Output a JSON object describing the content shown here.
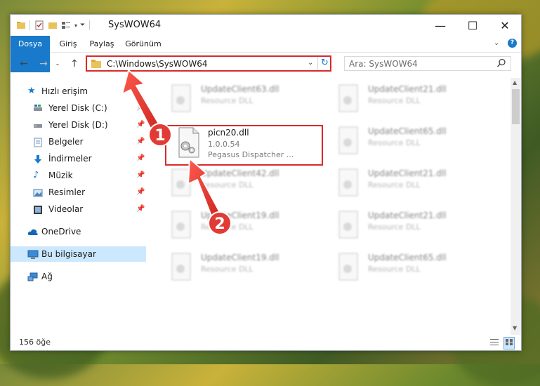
{
  "window": {
    "title": "SysWOW64",
    "minimize_glyph": "—",
    "maximize_glyph": "☐",
    "close_glyph": "✕"
  },
  "ribbon": {
    "tabs": [
      "Dosya",
      "Giriş",
      "Paylaş",
      "Görünüm"
    ]
  },
  "navigation": {
    "address": "C:\\Windows\\SysWOW64",
    "search_placeholder": "Ara: SysWOW64"
  },
  "sidebar": {
    "items": [
      {
        "label": "Hızlı erişim",
        "icon": "star-icon"
      },
      {
        "label": "Yerel Disk (C:)",
        "icon": "drive-icon"
      },
      {
        "label": "Yerel Disk (D:)",
        "icon": "drive-icon"
      },
      {
        "label": "Belgeler",
        "icon": "documents-icon"
      },
      {
        "label": "İndirmeler",
        "icon": "download-icon"
      },
      {
        "label": "Müzik",
        "icon": "music-icon"
      },
      {
        "label": "Resimler",
        "icon": "pictures-icon"
      },
      {
        "label": "Videolar",
        "icon": "video-icon"
      },
      {
        "label": "OneDrive",
        "icon": "cloud-icon"
      },
      {
        "label": "Bu bilgisayar",
        "icon": "computer-icon"
      },
      {
        "label": "Ağ",
        "icon": "network-icon"
      }
    ]
  },
  "files": {
    "focused": {
      "name": "picn20.dll",
      "version": "1.0.0.54",
      "description": "Pegasus Dispatcher ..."
    },
    "blurred": [
      {
        "name": "UpdateClient63.dll",
        "sub": "Resource DLL"
      },
      {
        "name": "UpdateClient21.dll",
        "sub": "Resource DLL"
      },
      {
        "name": "UpdateClient65.dll",
        "sub": "Resource DLL"
      },
      {
        "name": "UpdateClient42.dll",
        "sub": "Resource DLL"
      },
      {
        "name": "UpdateClient21.dll",
        "sub": "Resource DLL"
      },
      {
        "name": "UpdateClient19.dll",
        "sub": "Resource DLL"
      },
      {
        "name": "UpdateClient21.dll",
        "sub": "Resource DLL"
      },
      {
        "name": "UpdateClient19.dll",
        "sub": "Resource DLL"
      },
      {
        "name": "UpdateClient65.dll",
        "sub": "Resource DLL"
      }
    ]
  },
  "status": {
    "count": "156 öğe"
  },
  "annotations": {
    "badge1": "1",
    "badge2": "2"
  },
  "colors": {
    "accent": "#1979ca",
    "highlight": "#d62b2b",
    "arrow": "#e23b35"
  }
}
